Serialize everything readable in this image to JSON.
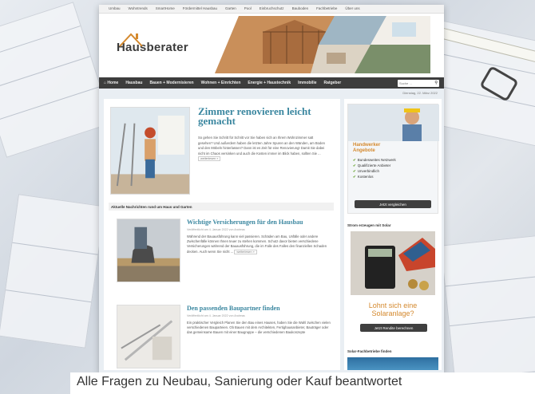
{
  "site": {
    "topnav": [
      "Umbau",
      "Wohntrends",
      "SmartHome",
      "Fördermittel Hausbau",
      "Garten",
      "Pool",
      "Einbruchschutz",
      "Bauboden",
      "Fachbetriebe",
      "Über uns"
    ],
    "logo_text": "Hausberater",
    "mainnav": [
      "Home",
      "Hausbau",
      "Bauen + Modernisieren",
      "Wohnen + Einrichten",
      "Energie + Haustechnik",
      "Immobilie",
      "Ratgeber"
    ],
    "search_placeholder": "Suche ...",
    "date": "Dienstag, 22. März 2022",
    "feature": {
      "title": "Zimmer renovieren leicht gemacht",
      "text": "So gehen Sie Schritt für Schritt vor Sie haben sich an Ihrem Wohnzimmer satt gesehen? Und außerdem haben die letzten Jahre Spuren an den Wänden, am Boden und den Möbeln hinterlassen? Dann ist es Zeit für eine Renovierung! Damit Sie dabei nicht im Chaos versinken und auch die Kosten immer im Blick haben, sollten Sie ...",
      "more": "weiterlesen »"
    },
    "section_title": "Aktuelle Nachrichten rund um Haus und Garten",
    "articles": [
      {
        "title": "Wichtige Versicherungen für den Hausbau",
        "meta": "Veröffentlicht am 4. Januar 2022 von Andreas",
        "text": "Während der Bauausführung kann viel passieren. Schäden am Bau, Unfälle oder andere Zwischenfälle können Ihnen teuer zu stehen kommen. Schutz davor bieten verschiedene Versicherungen während der Bauausführung, die im Falle des Falles den finanziellen Schaden decken. Auch wenn Sie nicht ...",
        "more": "weiterlesen »"
      },
      {
        "title": "Den passenden Baupartner finden",
        "meta": "Veröffentlicht am 4. Januar 2022 von Andreas",
        "text": "Ein praktischer Vergleich Planen Sie den Bau eines Hauses, haben Sie die Wahl zwischen vielen verschiedenen Bauparteien. Ob Bauen mit dem Architekten, Fertighausanbieter, Bauträger oder das gemeinsame Bauen mit einer Baugruppe – die verschiedenen Baukonzepte"
      }
    ],
    "sidebar": {
      "ad1": {
        "title_line1": "Handwerker",
        "title_line2": "Angebote",
        "items": [
          "Bundesweites Netzwerk",
          "Qualifizierte Anbieter",
          "Unverbindlich",
          "Kostenlos"
        ],
        "button": "Jetzt vergleichen"
      },
      "section2": "Strom erzeugen mit Solar",
      "ad2": {
        "title_line1": "Lohnt sich eine",
        "title_line2": "Solaranlage?",
        "button": "Jetzt Rendite berechnen"
      },
      "section3": "Solar-Fachbetriebe finden"
    }
  },
  "caption": "Alle Fragen zu Neubau, Sanierung oder Kauf beantwortet",
  "colors": {
    "accent_blue": "#3b87a0",
    "accent_orange": "#d4892e",
    "nav_dark": "#3d3d3d"
  }
}
